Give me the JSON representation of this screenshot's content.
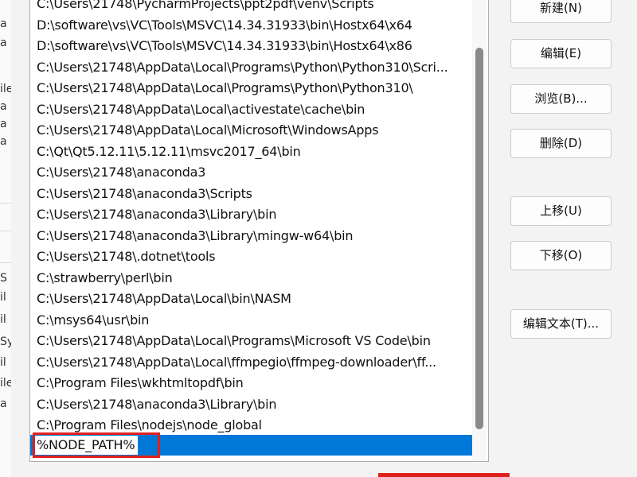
{
  "left_strip": {
    "fragments": [
      "a",
      "a",
      "ile",
      "a",
      "a",
      "a",
      "S",
      "il",
      "il",
      "Sy",
      "il",
      "ile",
      "a"
    ]
  },
  "path_list": {
    "items": [
      "C:\\Users\\21748\\PycharmProjects\\ppt2pdf\\venv\\Scripts",
      "D:\\software\\vs\\VC\\Tools\\MSVC\\14.34.31933\\bin\\Hostx64\\x64",
      "D:\\software\\vs\\VC\\Tools\\MSVC\\14.34.31933\\bin\\Hostx64\\x86",
      "C:\\Users\\21748\\AppData\\Local\\Programs\\Python\\Python310\\Scri...",
      "C:\\Users\\21748\\AppData\\Local\\Programs\\Python\\Python310\\",
      "C:\\Users\\21748\\AppData\\Local\\activestate\\cache\\bin",
      "C:\\Users\\21748\\AppData\\Local\\Microsoft\\WindowsApps",
      "C:\\Qt\\Qt5.12.11\\5.12.11\\msvc2017_64\\bin",
      "C:\\Users\\21748\\anaconda3",
      "C:\\Users\\21748\\anaconda3\\Scripts",
      "C:\\Users\\21748\\anaconda3\\Library\\bin",
      "C:\\Users\\21748\\anaconda3\\Library\\mingw-w64\\bin",
      "C:\\Users\\21748\\.dotnet\\tools",
      "C:\\strawberry\\perl\\bin",
      "C:\\Users\\21748\\AppData\\Local\\bin\\NASM",
      "C:\\msys64\\usr\\bin",
      "C:\\Users\\21748\\AppData\\Local\\Programs\\Microsoft VS Code\\bin",
      "C:\\Users\\21748\\AppData\\Local\\ffmpegio\\ffmpeg-downloader\\ff...",
      "C:\\Program Files\\wkhtmltopdf\\bin",
      "C:\\Users\\21748\\anaconda3\\Library\\bin",
      "C:\\Program Files\\nodejs\\node_global"
    ],
    "editing_value": "%NODE_PATH%"
  },
  "buttons": {
    "new": "新建(N)",
    "edit": "编辑(E)",
    "browse": "浏览(B)...",
    "delete": "删除(D)",
    "move_up": "上移(U)",
    "move_down": "下移(O)",
    "edit_text": "编辑文本(T)..."
  },
  "colors": {
    "selection": "#0078d7",
    "highlight_box": "#e0201c"
  }
}
